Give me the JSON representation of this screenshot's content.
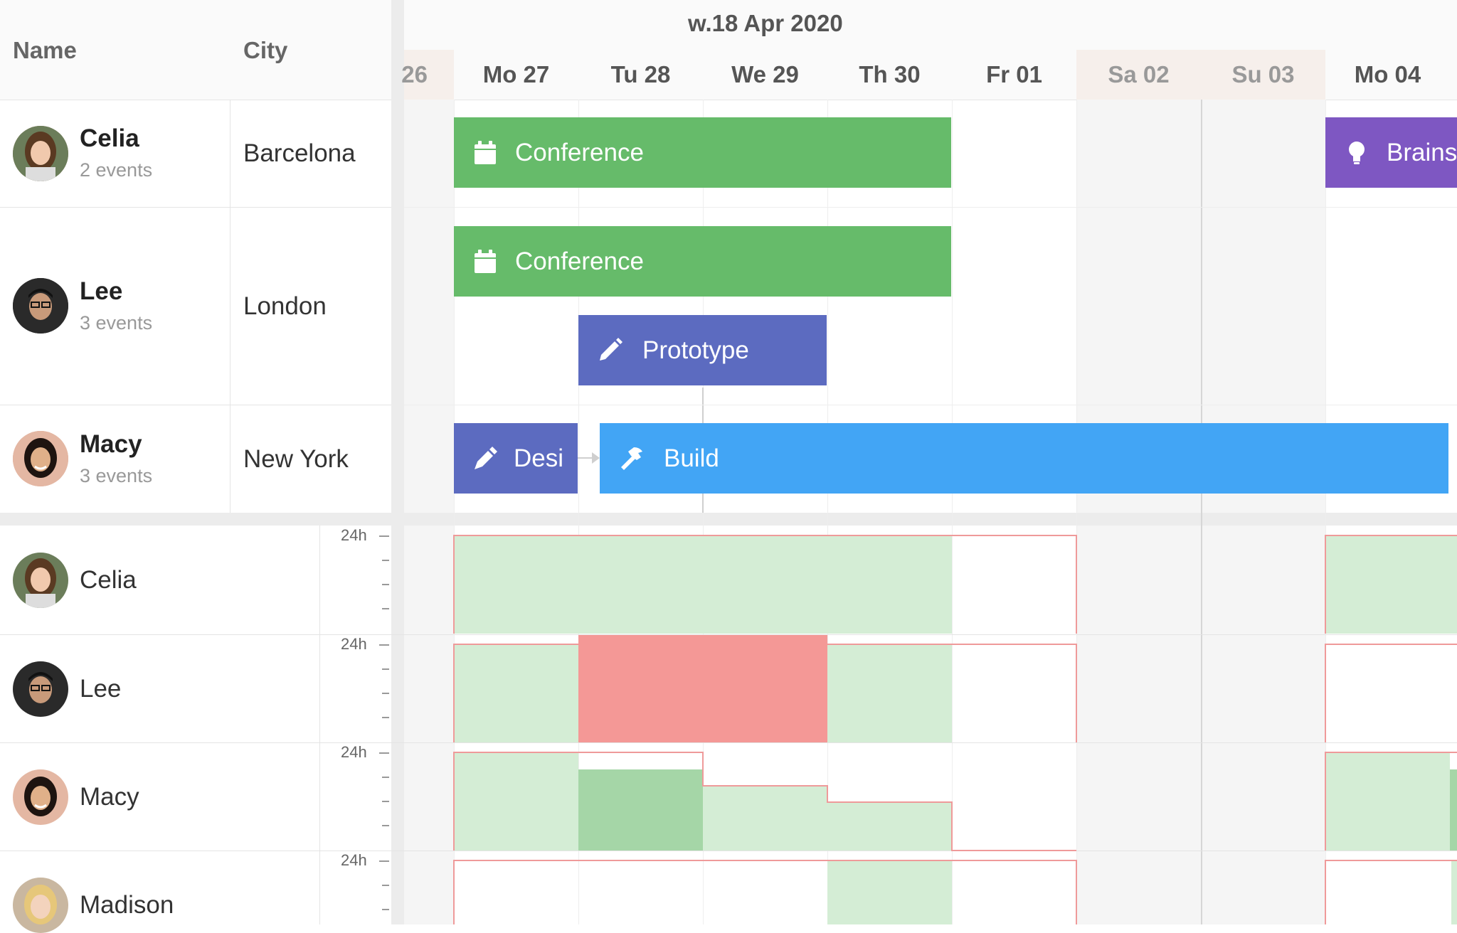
{
  "columns": {
    "name": "Name",
    "city": "City"
  },
  "timeline": {
    "week": "w.18 Apr 2020",
    "days": [
      {
        "label": "26",
        "weekend": true
      },
      {
        "label": "Mo 27",
        "weekend": false
      },
      {
        "label": "Tu 28",
        "weekend": false
      },
      {
        "label": "We 29",
        "weekend": false
      },
      {
        "label": "Th 30",
        "weekend": false
      },
      {
        "label": "Fr 01",
        "weekend": false
      },
      {
        "label": "Sa 02",
        "weekend": true
      },
      {
        "label": "Su 03",
        "weekend": true
      },
      {
        "label": "Mo 04",
        "weekend": false
      }
    ]
  },
  "resources": [
    {
      "name": "Celia",
      "events": "2 events",
      "city": "Barcelona"
    },
    {
      "name": "Lee",
      "events": "3 events",
      "city": "London"
    },
    {
      "name": "Macy",
      "events": "3 events",
      "city": "New York"
    }
  ],
  "events": [
    {
      "label": "Conference",
      "icon": "calendar-icon",
      "color": "#66bb6a"
    },
    {
      "label": "Brainst",
      "icon": "lightbulb-icon",
      "color": "#7e57c2"
    },
    {
      "label": "Conference",
      "icon": "calendar-icon",
      "color": "#66bb6a"
    },
    {
      "label": "Prototype",
      "icon": "pencil-icon",
      "color": "#5c6bc0"
    },
    {
      "label": "Desi",
      "icon": "pen-icon",
      "color": "#5c6bc0"
    },
    {
      "label": "Build",
      "icon": "hammer-icon",
      "color": "#42a5f5"
    }
  ],
  "histogram": {
    "scale_label": "24h",
    "rows": [
      {
        "name": "Celia"
      },
      {
        "name": "Lee"
      },
      {
        "name": "Macy"
      },
      {
        "name": "Madison"
      }
    ]
  }
}
